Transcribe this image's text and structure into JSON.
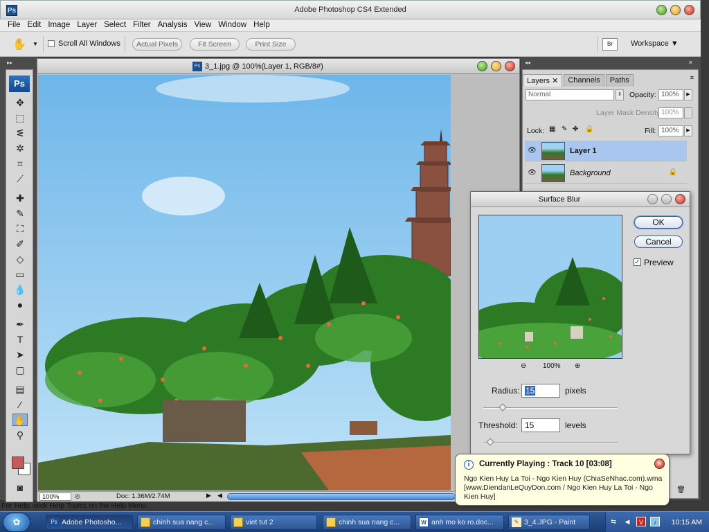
{
  "app": {
    "title": "Adobe Photoshop CS4 Extended",
    "icon_label": "Ps"
  },
  "menu": [
    "File",
    "Edit",
    "Image",
    "Layer",
    "Select",
    "Filter",
    "Analysis",
    "View",
    "Window",
    "Help"
  ],
  "options_bar": {
    "scroll_all_windows": "Scroll All Windows",
    "actual_pixels": "Actual Pixels",
    "fit_screen": "Fit Screen",
    "print_size": "Print Size",
    "workspace": "Workspace"
  },
  "toolbox": {
    "logo": "Ps",
    "tools": [
      "move-tool",
      "marquee-tool",
      "lasso-tool",
      "magic-wand-tool",
      "crop-tool",
      "eyedropper-tool",
      "healing-brush-tool",
      "brush-tool",
      "clone-stamp-tool",
      "history-brush-tool",
      "eraser-tool",
      "gradient-tool",
      "blur-tool",
      "dodge-tool",
      "pen-tool",
      "type-tool",
      "path-selection-tool",
      "rectangle-tool",
      "notes-tool",
      "eyedropper-tool-2",
      "hand-tool",
      "zoom-tool"
    ],
    "foreground_color": "#c6595c",
    "background_color": "#ffffff"
  },
  "document": {
    "title": "3_1.jpg @ 100%(Layer 1, RGB/8#)",
    "zoom": "100%",
    "doc_info": "Doc: 1.36M/2.74M"
  },
  "layers_panel": {
    "tabs": [
      "Layers",
      "Channels",
      "Paths"
    ],
    "blend_mode": "Normal",
    "opacity_label": "Opacity:",
    "opacity_value": "100%",
    "mask_density_label": "Layer Mask Density",
    "mask_density_value": "100%",
    "lock_label": "Lock:",
    "fill_label": "Fill:",
    "fill_value": "100%",
    "layers": [
      {
        "name": "Layer 1",
        "selected": true
      },
      {
        "name": "Background",
        "selected": false
      }
    ]
  },
  "surface_blur": {
    "title": "Surface Blur",
    "ok": "OK",
    "cancel": "Cancel",
    "preview": "Preview",
    "preview_checked": true,
    "zoom": "100%",
    "radius_label": "Radius:",
    "radius_value": "15",
    "radius_unit": "pixels",
    "threshold_label": "Threshold:",
    "threshold_value": "15",
    "threshold_unit": "levels"
  },
  "notification": {
    "title": "Currently Playing : Track 10 [03:08]",
    "body": "Ngo Kien Huy La Toi - Ngo Kien Huy (ChiaSeNhac.com).wma [www.DiendanLeQuyDon.com / Ngo Kien Huy La Toi - Ngo Kien Huy]"
  },
  "help_line": "For Help, click Help Topics on the Help Menu.",
  "taskbar": {
    "items": [
      {
        "label": "Adobe Photosho...",
        "icon": "photoshop-icon",
        "active": true
      },
      {
        "label": "chinh sua nang c...",
        "icon": "folder-icon",
        "active": false
      },
      {
        "label": "viet tut 2",
        "icon": "folder-icon",
        "active": false
      },
      {
        "label": "chinh sua nang c...",
        "icon": "folder-icon",
        "active": false
      },
      {
        "label": "anh mo ko ro.doc...",
        "icon": "word-icon",
        "active": false
      },
      {
        "label": "3_4.JPG - Paint",
        "icon": "paint-icon",
        "active": false
      }
    ],
    "clock": "10:15 AM"
  }
}
